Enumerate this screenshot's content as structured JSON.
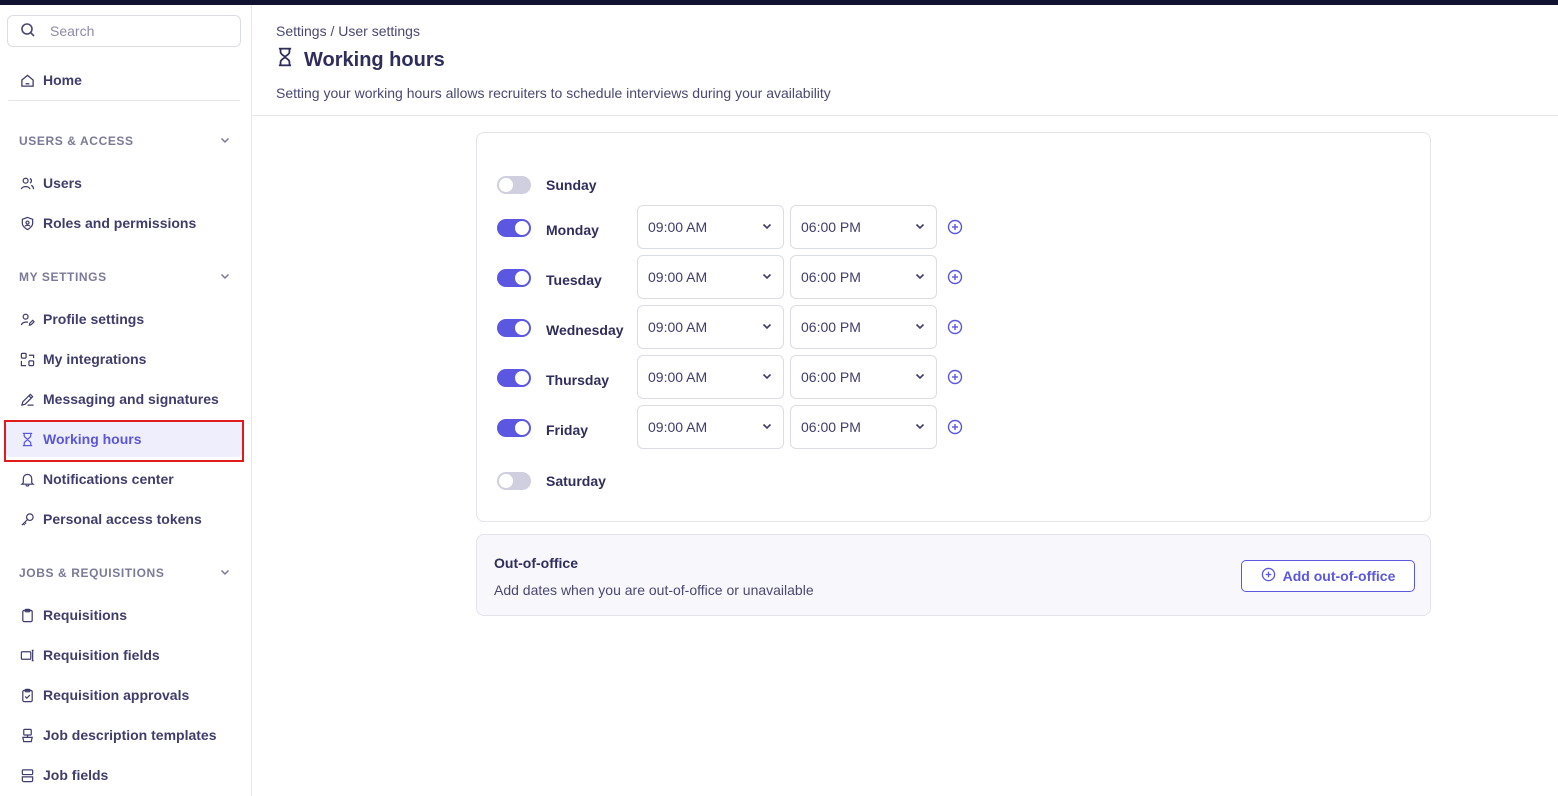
{
  "search": {
    "placeholder": "Search"
  },
  "sidebar": {
    "home": {
      "label": "Home",
      "icon": "home-icon"
    },
    "sections": [
      {
        "title": "USERS & ACCESS",
        "items": [
          {
            "label": "Users",
            "icon": "users-icon"
          },
          {
            "label": "Roles and permissions",
            "icon": "shield-icon"
          }
        ]
      },
      {
        "title": "MY SETTINGS",
        "items": [
          {
            "label": "Profile settings",
            "icon": "user-edit-icon"
          },
          {
            "label": "My integrations",
            "icon": "integrations-icon"
          },
          {
            "label": "Messaging and signatures",
            "icon": "signature-icon"
          },
          {
            "label": "Working hours",
            "icon": "hourglass-icon",
            "active": true
          },
          {
            "label": "Notifications center",
            "icon": "bell-icon"
          },
          {
            "label": "Personal access tokens",
            "icon": "key-icon"
          }
        ]
      },
      {
        "title": "JOBS & REQUISITIONS",
        "items": [
          {
            "label": "Requisitions",
            "icon": "clipboard-icon"
          },
          {
            "label": "Requisition fields",
            "icon": "fields-icon"
          },
          {
            "label": "Requisition approvals",
            "icon": "clipboard-check-icon"
          },
          {
            "label": "Job description templates",
            "icon": "template-icon"
          },
          {
            "label": "Job fields",
            "icon": "job-fields-icon"
          }
        ]
      }
    ]
  },
  "header": {
    "breadcrumb": "Settings / User settings",
    "title": "Working hours",
    "title_icon": "hourglass-icon",
    "subtitle": "Setting your working hours allows recruiters to schedule interviews during your availability"
  },
  "schedule": {
    "days": [
      {
        "name": "Sunday",
        "enabled": false
      },
      {
        "name": "Monday",
        "enabled": true,
        "start": "09:00 AM",
        "end": "06:00 PM"
      },
      {
        "name": "Tuesday",
        "enabled": true,
        "start": "09:00 AM",
        "end": "06:00 PM"
      },
      {
        "name": "Wednesday",
        "enabled": true,
        "start": "09:00 AM",
        "end": "06:00 PM"
      },
      {
        "name": "Thursday",
        "enabled": true,
        "start": "09:00 AM",
        "end": "06:00 PM"
      },
      {
        "name": "Friday",
        "enabled": true,
        "start": "09:00 AM",
        "end": "06:00 PM"
      },
      {
        "name": "Saturday",
        "enabled": false
      }
    ]
  },
  "out_of_office": {
    "title": "Out-of-office",
    "description": "Add dates when you are out-of-office or unavailable",
    "button_label": "Add out-of-office"
  },
  "colors": {
    "accent": "#5b57e0",
    "highlight_box": "#e11b1b",
    "toggle_off": "#cfcfe0",
    "text": "#3f3d6b"
  }
}
